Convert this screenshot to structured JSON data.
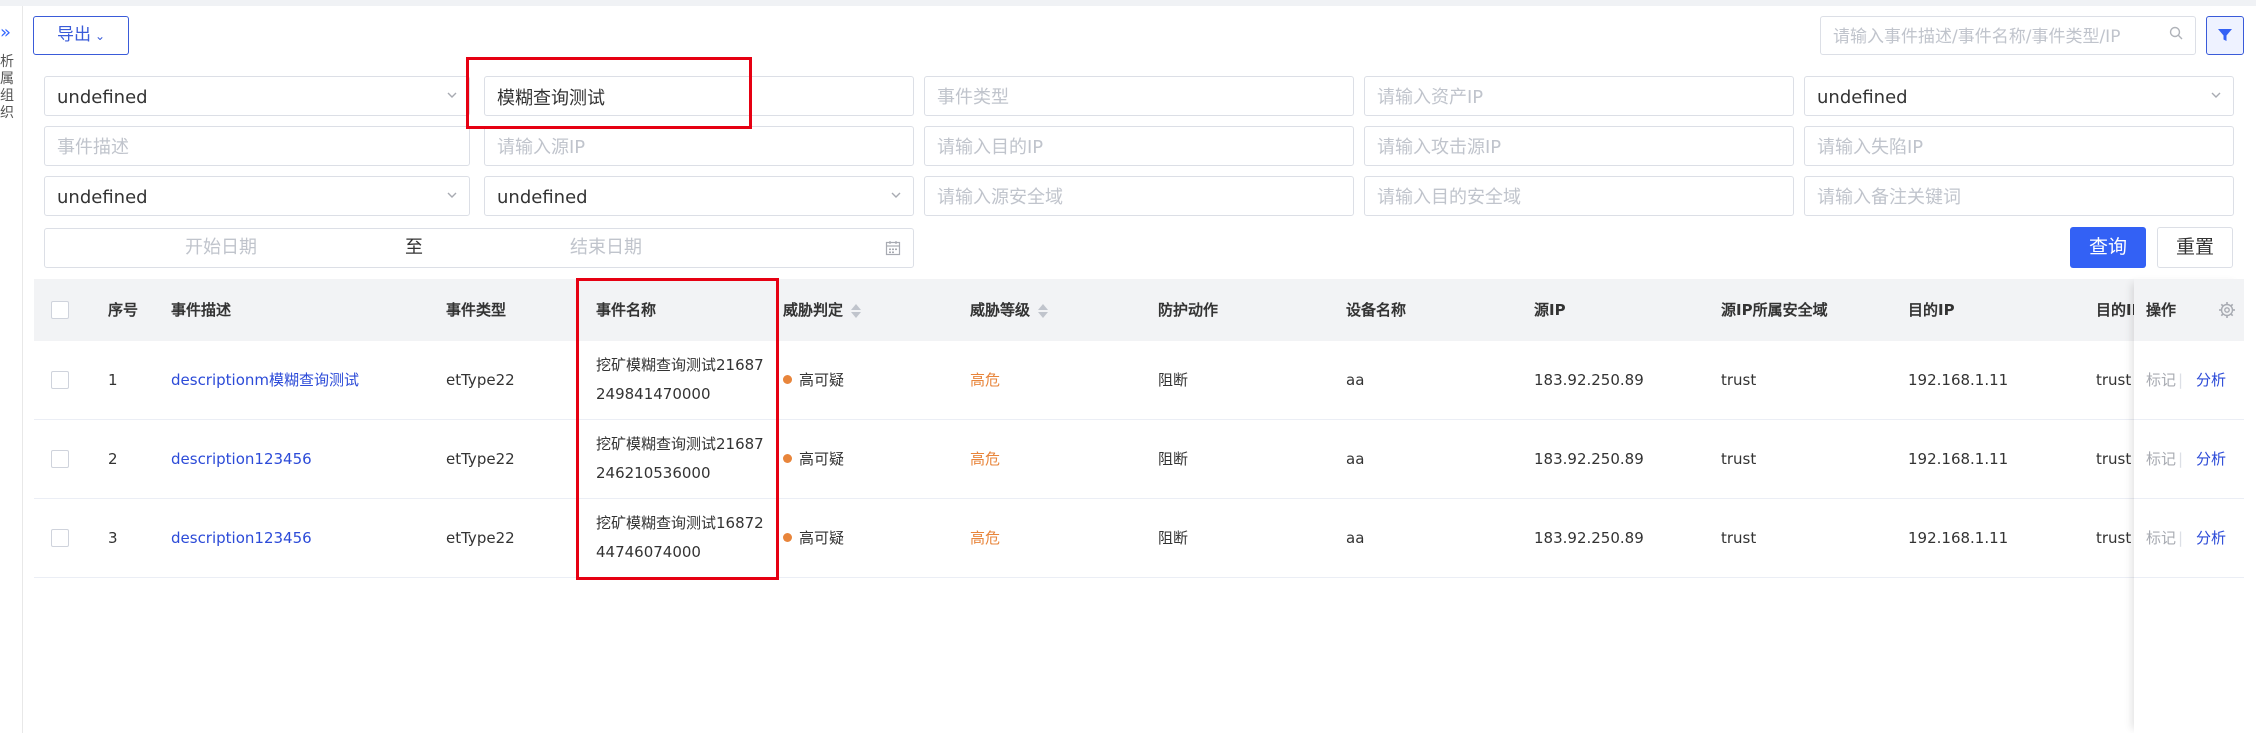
{
  "left_panel": {
    "vertical_chars": [
      "析",
      "属",
      "组",
      "织"
    ]
  },
  "toolbar": {
    "export_label": "导出",
    "search_placeholder": "请输入事件描述/事件名称/事件类型/IP"
  },
  "filters": {
    "row1": {
      "select1_value": "undefined",
      "event_name_value": "模糊查询测试",
      "event_type_placeholder": "事件类型",
      "asset_ip_placeholder": "请输入资产IP",
      "select2_value": "undefined"
    },
    "row2": {
      "event_desc_placeholder": "事件描述",
      "source_ip_placeholder": "请输入源IP",
      "dest_ip_placeholder": "请输入目的IP",
      "attack_ip_placeholder": "请输入攻击源IP",
      "fallen_ip_placeholder": "请输入失陷IP"
    },
    "row3": {
      "select3_value": "undefined",
      "select4_value": "undefined",
      "source_zone_placeholder": "请输入源安全域",
      "dest_zone_placeholder": "请输入目的安全域",
      "remark_placeholder": "请输入备注关键词"
    },
    "date": {
      "start_placeholder": "开始日期",
      "separator": "至",
      "end_placeholder": "结束日期"
    },
    "query_label": "查询",
    "reset_label": "重置"
  },
  "table": {
    "headers": {
      "index": "序号",
      "desc": "事件描述",
      "type": "事件类型",
      "name": "事件名称",
      "verdict": "威胁判定",
      "level": "威胁等级",
      "action": "防护动作",
      "device": "设备名称",
      "src_ip": "源IP",
      "src_zone": "源IP所属安全域",
      "dst_ip": "目的IP",
      "dst_ip2": "目的II",
      "ops": "操作"
    },
    "rows": [
      {
        "index": "1",
        "desc": "descriptionm模糊查询测试",
        "type": "etType22",
        "name": "挖矿模糊查询测试21687249841470000",
        "verdict": "高可疑",
        "level": "高危",
        "action": "阻断",
        "device": "aa",
        "src_ip": "183.92.250.89",
        "src_zone": "trust",
        "dst_ip": "192.168.1.11",
        "dst_zone": "trust",
        "op_mark": "标记",
        "op_sep": "|",
        "op_analyze": "分析"
      },
      {
        "index": "2",
        "desc": "description123456",
        "type": "etType22",
        "name": "挖矿模糊查询测试21687246210536000",
        "verdict": "高可疑",
        "level": "高危",
        "action": "阻断",
        "device": "aa",
        "src_ip": "183.92.250.89",
        "src_zone": "trust",
        "dst_ip": "192.168.1.11",
        "dst_zone": "trust",
        "op_mark": "标记",
        "op_sep": "|",
        "op_analyze": "分析"
      },
      {
        "index": "3",
        "desc": "description123456",
        "type": "etType22",
        "name": "挖矿模糊查询测试1687244746074000",
        "verdict": "高可疑",
        "level": "高危",
        "action": "阻断",
        "device": "aa",
        "src_ip": "183.92.250.89",
        "src_zone": "trust",
        "dst_ip": "192.168.1.11",
        "dst_zone": "trust",
        "op_mark": "标记",
        "op_sep": "|",
        "op_analyze": "分析"
      }
    ]
  },
  "colors": {
    "primary": "#3361f5",
    "link": "#2c4bd8",
    "warning_orange": "#e8853b",
    "annotation_red": "#e60012"
  }
}
